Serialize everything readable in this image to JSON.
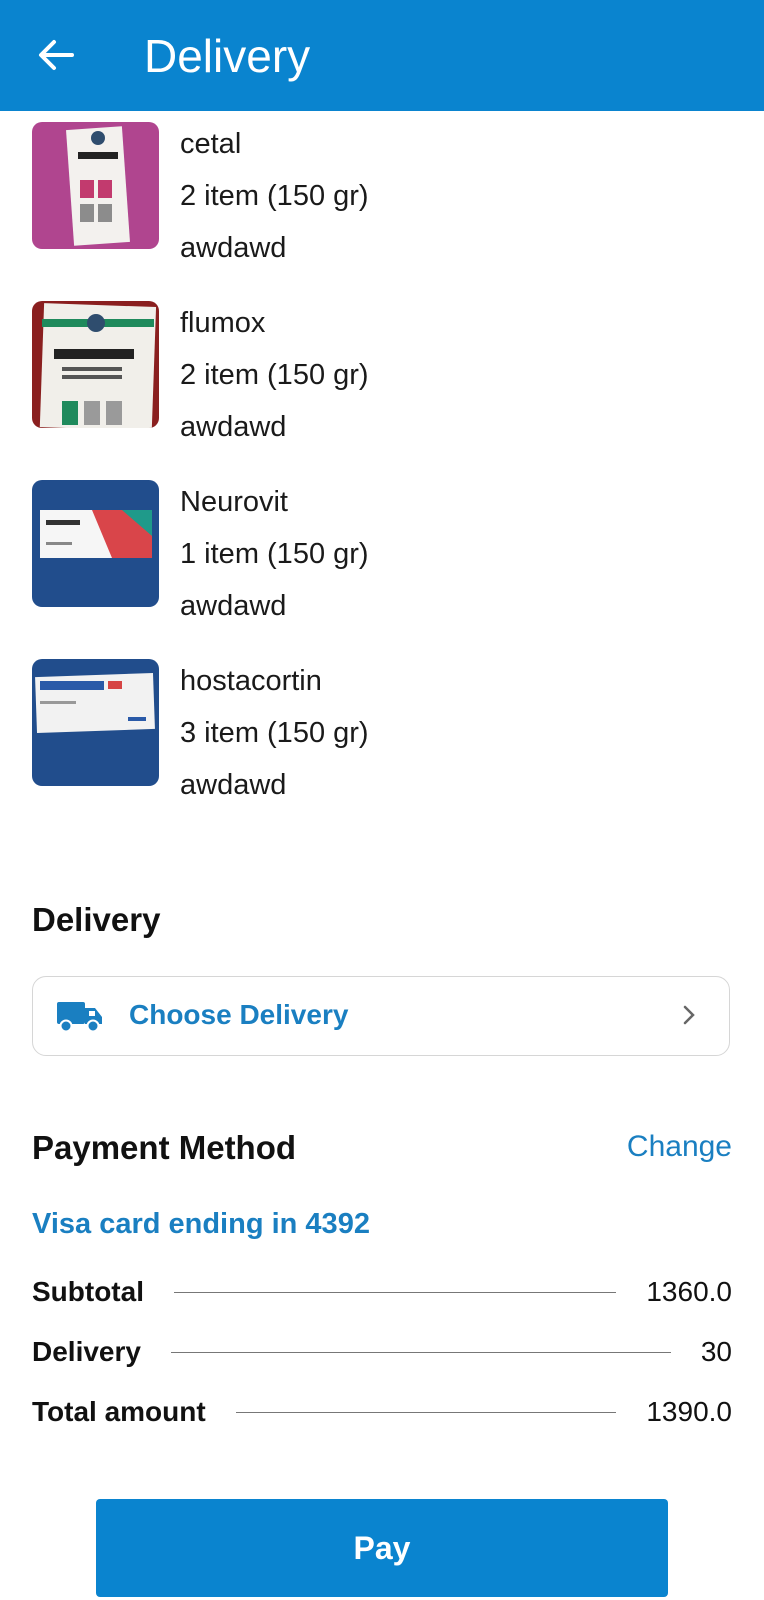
{
  "header": {
    "title": "Delivery",
    "back_icon": "arrow-left-icon",
    "bg_color": "#0a84cf"
  },
  "items": [
    {
      "name": "cetal",
      "qty": "2 item (150 gr)",
      "note": "awdawd",
      "image": "cetal-box-image"
    },
    {
      "name": "flumox",
      "qty": "2 item (150 gr)",
      "note": "awdawd",
      "image": "flumox-box-image"
    },
    {
      "name": "Neurovit",
      "qty": "1 item (150 gr)",
      "note": "awdawd",
      "image": "neurovit-box-image"
    },
    {
      "name": "hostacortin",
      "qty": "3 item (150 gr)",
      "note": "awdawd",
      "image": "hostacortin-box-image"
    }
  ],
  "delivery": {
    "section_title": "Delivery",
    "choose_label": "Choose Delivery",
    "icon": "truck-icon",
    "chevron": "chevron-right-icon"
  },
  "payment": {
    "section_title": "Payment Method",
    "change_label": "Change",
    "card_text": "Visa card ending in 4392",
    "accent_color": "#1a7fc1"
  },
  "summary": {
    "subtotal_label": "Subtotal",
    "subtotal_value": "1360.0",
    "delivery_label": "Delivery",
    "delivery_value": "30",
    "total_label": "Total amount",
    "total_value": "1390.0"
  },
  "pay_button": {
    "label": "Pay"
  }
}
